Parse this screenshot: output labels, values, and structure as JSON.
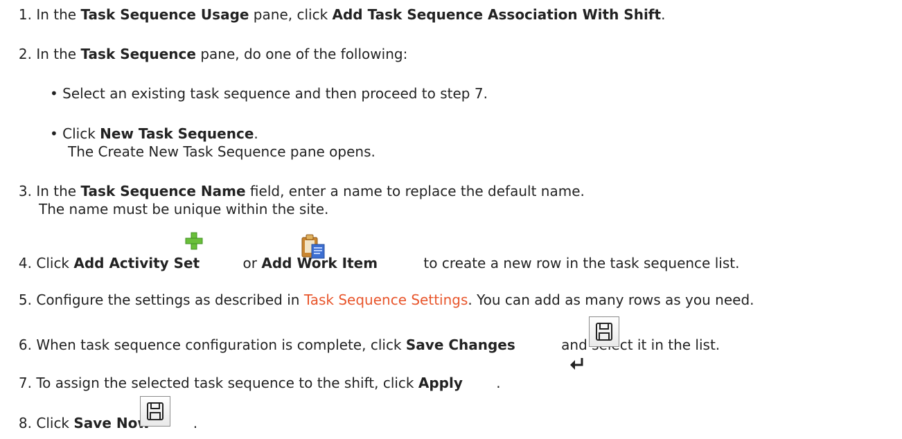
{
  "steps": [
    {
      "num": "1.",
      "a": "In the ",
      "b1": "Task Sequence Usage",
      "c": " pane, click ",
      "b2": "Add Task Sequence Association With Shift",
      "d": "."
    },
    {
      "num": "2.",
      "a": "In the ",
      "b1": "Task Sequence",
      "c": " pane, do one of the following:"
    },
    {
      "num": "3.",
      "a": "In the ",
      "b1": "Task Sequence Name",
      "c": " field, enter a name to replace the default name.",
      "note": "The name must be unique within the site."
    },
    {
      "num": "4.",
      "a": "Click ",
      "b1": "Add Activity Set",
      "c": " or ",
      "b2": "Add Work Item",
      "d": " to create a new row in the task sequence list."
    },
    {
      "num": "5.",
      "a": "Configure the settings as described in ",
      "link": "Task Sequence Settings",
      "c": ". You can add as many rows as you need."
    },
    {
      "num": "6.",
      "a": "When task sequence configuration is complete, click ",
      "b1": "Save Changes",
      "d": " and select it in the list."
    },
    {
      "num": "7.",
      "a": "To assign the selected task sequence to the shift, click ",
      "b1": "Apply",
      "d": " ."
    },
    {
      "num": "8.",
      "a": "Click ",
      "b1": "Save Now",
      "d": "."
    }
  ],
  "substeps": [
    {
      "bullet": "•",
      "text": "Select an existing task sequence and then proceed to step 7."
    },
    {
      "bullet": "•",
      "a": "Click ",
      "b1": "New Task Sequence",
      "c": ".",
      "note": "The Create New Task Sequence pane opens."
    }
  ],
  "icons": {
    "add_activity_set": "green-plus-icon",
    "add_work_item": "clipboard-document-icon",
    "save_changes": "floppy-disk-icon",
    "apply": "return-arrow-icon",
    "save_now": "floppy-disk-icon"
  },
  "colors": {
    "link": "#e8552b",
    "text": "#222222",
    "plus": "#6abf3a"
  }
}
